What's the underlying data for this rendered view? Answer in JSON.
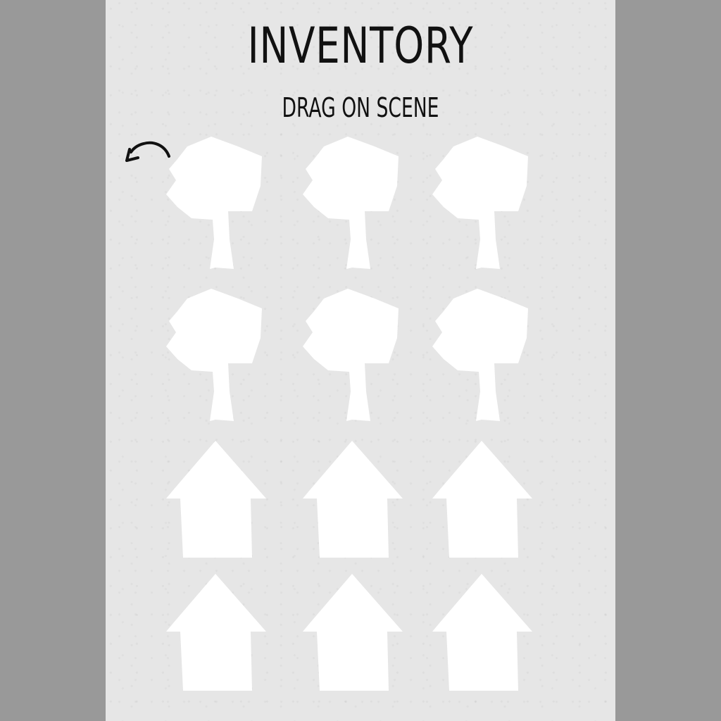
{
  "header": {
    "title": "INVENTORY",
    "subtitle": "DRAG ON SCENE"
  },
  "back_button": {
    "icon": "curved-back-arrow-icon"
  },
  "inventory": {
    "rows": [
      {
        "item": "tree",
        "count": 3
      },
      {
        "item": "tree",
        "count": 3
      },
      {
        "item": "house",
        "count": 3
      },
      {
        "item": "house",
        "count": 3
      }
    ]
  },
  "colors": {
    "outer_background": "#999999",
    "panel_background": "#e6e6e6",
    "item_fill": "#ffffff",
    "text": "#111111"
  }
}
